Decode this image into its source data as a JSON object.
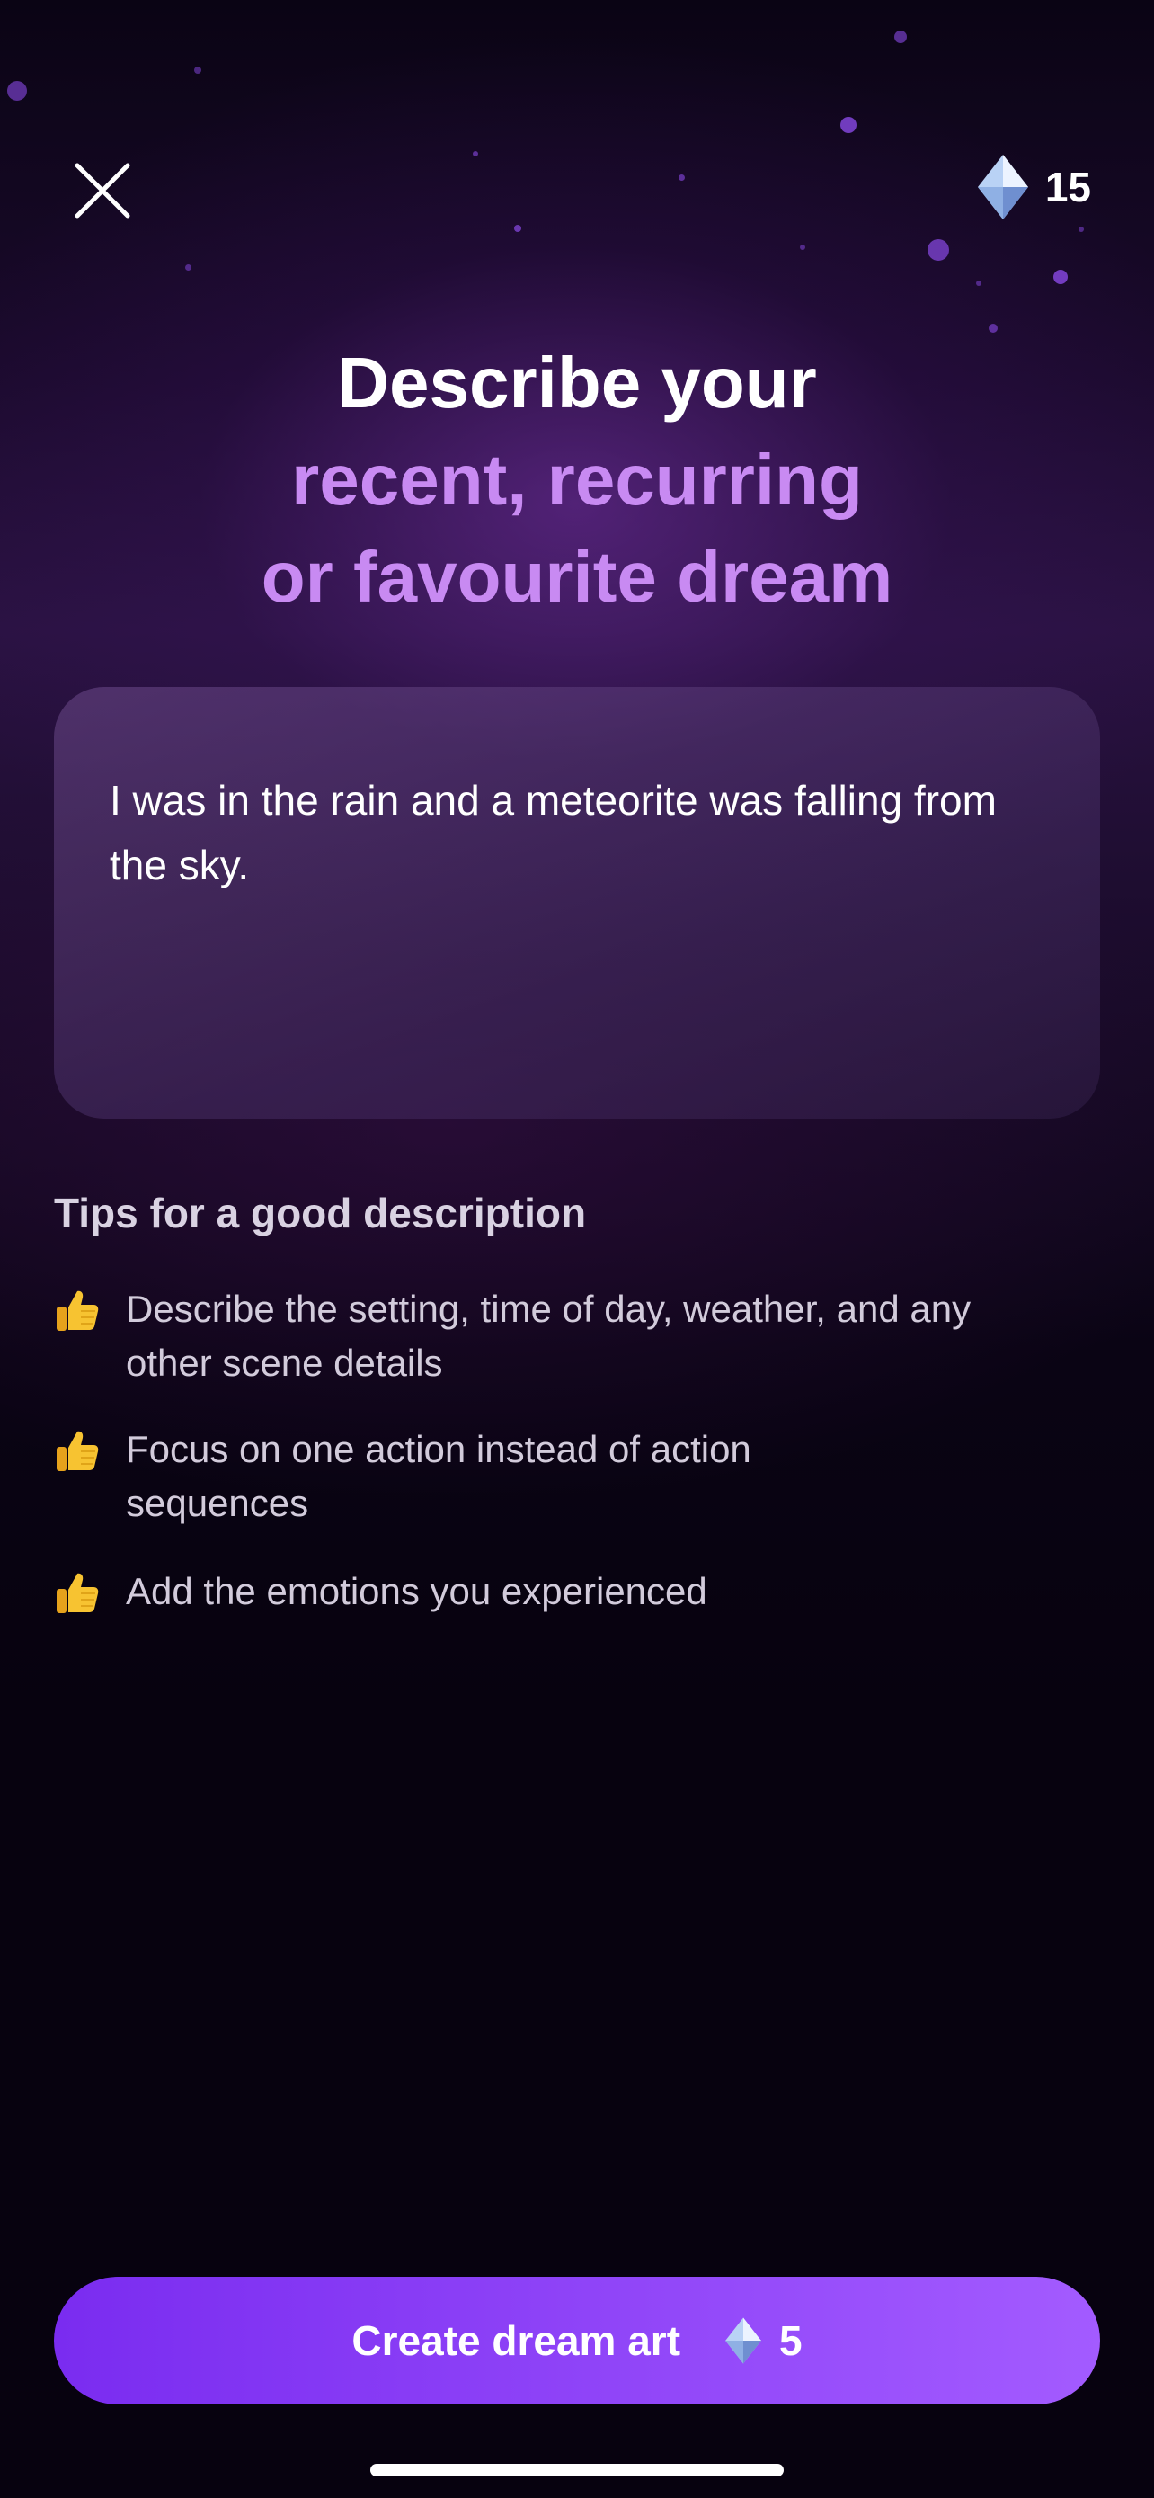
{
  "header": {
    "close_icon": "close-icon",
    "gem_icon": "diamond-gem-icon",
    "gem_balance": "15"
  },
  "title": {
    "line1": "Describe your",
    "line2": "recent, recurring",
    "line3": "or favourite dream"
  },
  "dream_input": {
    "value": "I was in the rain and a meteorite was falling from the sky."
  },
  "tips": {
    "heading": "Tips for a good description",
    "icon": "thumbs-up-icon",
    "items": [
      "Describe the setting, time of day, weather, and any other scene details",
      "Focus on one action instead of action sequences",
      "Add the emotions you experienced"
    ]
  },
  "cta": {
    "label": "Create dream art",
    "gem_icon": "diamond-gem-icon",
    "cost": "5"
  },
  "colors": {
    "background": "#07020f",
    "accent_purple": "#c88af2",
    "button_gradient_start": "#7a2cf0",
    "button_gradient_end": "#a35bff"
  }
}
